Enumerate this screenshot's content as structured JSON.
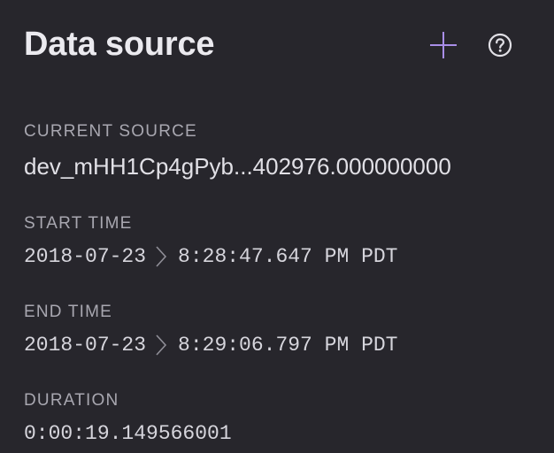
{
  "header": {
    "title": "Data source"
  },
  "icons": {
    "add": "plus-icon",
    "help": "help-circle-icon",
    "separator": "chevron-right-icon"
  },
  "colors": {
    "background": "#27262c",
    "accent": "#a98ee8",
    "label": "#a8a7b0",
    "text": "#e1e0e6"
  },
  "current_source": {
    "label": "CURRENT SOURCE",
    "value": "dev_mHH1Cp4gPyb...402976.000000000"
  },
  "start_time": {
    "label": "START TIME",
    "date": "2018-07-23",
    "time": "8:28:47.647 PM PDT"
  },
  "end_time": {
    "label": "END TIME",
    "date": "2018-07-23",
    "time": "8:29:06.797 PM PDT"
  },
  "duration": {
    "label": "DURATION",
    "value": "0:00:19.149566001"
  }
}
